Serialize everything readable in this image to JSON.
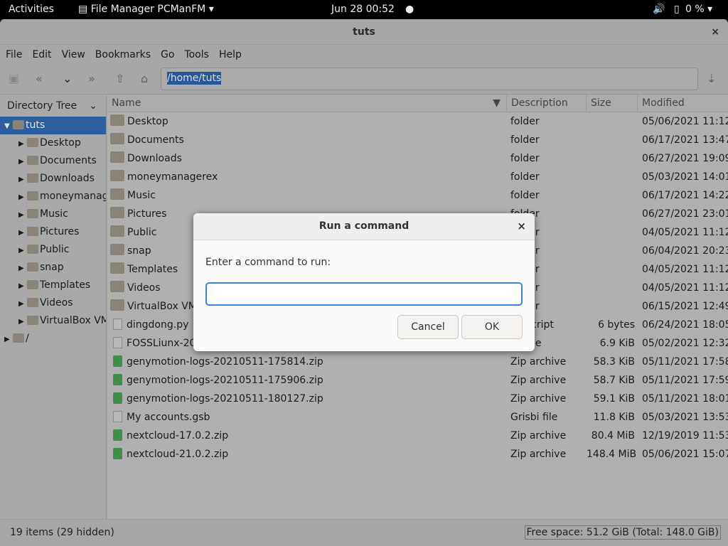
{
  "topbar": {
    "activities": "Activities",
    "app": "File Manager PCManFM ▾",
    "clock": "Jun 28  00:52",
    "battery": "0 % ▾"
  },
  "window": {
    "title": "tuts",
    "close": "×"
  },
  "menu": [
    "File",
    "Edit",
    "View",
    "Bookmarks",
    "Go",
    "Tools",
    "Help"
  ],
  "toolbar": {
    "path": "/home/tuts"
  },
  "sidebar": {
    "header": "Directory Tree",
    "items": [
      {
        "label": "tuts",
        "level": 0,
        "selected": true
      },
      {
        "label": "Desktop",
        "level": 1
      },
      {
        "label": "Documents",
        "level": 1
      },
      {
        "label": "Downloads",
        "level": 1
      },
      {
        "label": "moneymanagerex",
        "level": 1
      },
      {
        "label": "Music",
        "level": 1
      },
      {
        "label": "Pictures",
        "level": 1
      },
      {
        "label": "Public",
        "level": 1
      },
      {
        "label": "snap",
        "level": 1
      },
      {
        "label": "Templates",
        "level": 1
      },
      {
        "label": "Videos",
        "level": 1
      },
      {
        "label": "VirtualBox VMs",
        "level": 1
      },
      {
        "label": "/",
        "level": 0
      }
    ]
  },
  "columns": [
    "Name",
    "Description",
    "Size",
    "Modified"
  ],
  "files": [
    {
      "name": "Desktop",
      "type": "folder",
      "desc": "folder",
      "size": "",
      "mod": "05/06/2021 11:12"
    },
    {
      "name": "Documents",
      "type": "folder",
      "desc": "folder",
      "size": "",
      "mod": "06/17/2021 13:47"
    },
    {
      "name": "Downloads",
      "type": "folder",
      "desc": "folder",
      "size": "",
      "mod": "06/27/2021 19:09"
    },
    {
      "name": "moneymanagerex",
      "type": "folder",
      "desc": "folder",
      "size": "",
      "mod": "05/03/2021 14:01"
    },
    {
      "name": "Music",
      "type": "folder",
      "desc": "folder",
      "size": "",
      "mod": "06/17/2021 14:22"
    },
    {
      "name": "Pictures",
      "type": "folder",
      "desc": "folder",
      "size": "",
      "mod": "06/27/2021 23:01"
    },
    {
      "name": "Public",
      "type": "folder",
      "desc": "folder",
      "size": "",
      "mod": "04/05/2021 11:12"
    },
    {
      "name": "snap",
      "type": "folder",
      "desc": "folder",
      "size": "",
      "mod": "06/04/2021 20:23"
    },
    {
      "name": "Templates",
      "type": "folder",
      "desc": "folder",
      "size": "",
      "mod": "04/05/2021 11:12"
    },
    {
      "name": "Videos",
      "type": "folder",
      "desc": "folder",
      "size": "",
      "mod": "04/05/2021 11:12"
    },
    {
      "name": "VirtualBox VMs",
      "type": "folder",
      "desc": "folder",
      "size": "",
      "mod": "06/15/2021 12:49"
    },
    {
      "name": "dingdong.py",
      "type": "file",
      "desc": "on script",
      "size": "6 bytes",
      "mod": "06/24/2021 18:05"
    },
    {
      "name": "FOSSLiunx-20",
      "type": "file",
      "desc": "up file",
      "size": "6.9 KiB",
      "mod": "05/02/2021 12:32"
    },
    {
      "name": "genymotion-logs-20210511-175814.zip",
      "type": "zip",
      "desc": "Zip archive",
      "size": "58.3 KiB",
      "mod": "05/11/2021 17:58"
    },
    {
      "name": "genymotion-logs-20210511-175906.zip",
      "type": "zip",
      "desc": "Zip archive",
      "size": "58.7 KiB",
      "mod": "05/11/2021 17:59"
    },
    {
      "name": "genymotion-logs-20210511-180127.zip",
      "type": "zip",
      "desc": "Zip archive",
      "size": "59.1 KiB",
      "mod": "05/11/2021 18:01"
    },
    {
      "name": "My accounts.gsb",
      "type": "file",
      "desc": "Grisbi file",
      "size": "11.8 KiB",
      "mod": "05/03/2021 13:53"
    },
    {
      "name": "nextcloud-17.0.2.zip",
      "type": "zip",
      "desc": "Zip archive",
      "size": "80.4 MiB",
      "mod": "12/19/2019 11:53"
    },
    {
      "name": "nextcloud-21.0.2.zip",
      "type": "zip",
      "desc": "Zip archive",
      "size": "148.4 MiB",
      "mod": "05/06/2021 15:07"
    }
  ],
  "status": {
    "items": "19 items (29 hidden)",
    "free": "Free space: 51.2 GiB (Total: 148.0 GiB)"
  },
  "dialog": {
    "title": "Run a command",
    "close": "×",
    "label": "Enter a command to run:",
    "value": "",
    "cancel": "Cancel",
    "ok": "OK"
  }
}
